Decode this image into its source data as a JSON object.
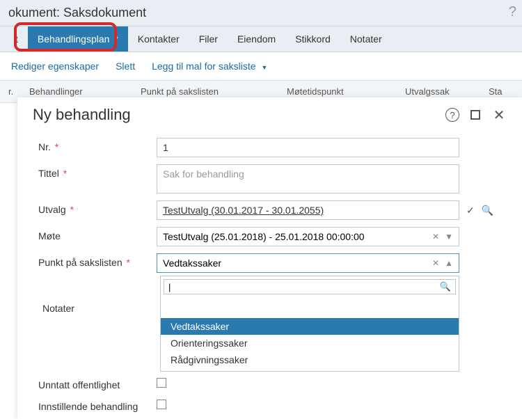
{
  "header": {
    "title_prefix": "okument: Saksdokument"
  },
  "tabs": {
    "left_cut": "t",
    "behandlingsplan": "Behandlingsplan",
    "kontakter": "Kontakter",
    "filer": "Filer",
    "eiendom": "Eiendom",
    "stikkord": "Stikkord",
    "notater": "Notater",
    "asterisk": "*"
  },
  "toolbar": {
    "rediger": "Rediger egenskaper",
    "slett": "Slett",
    "leggtil": "Legg til mal for saksliste"
  },
  "columns": {
    "r": "r.",
    "behandlinger": "Behandlinger",
    "punkt": "Punkt på sakslisten",
    "motetid": "Møtetidspunkt",
    "utvalgssak": "Utvalgssak",
    "sta": "Sta"
  },
  "modal": {
    "title": "Ny behandling",
    "fields": {
      "nr_label": "Nr.",
      "nr_value": "1",
      "tittel_label": "Tittel",
      "tittel_placeholder": "Sak for behandling",
      "utvalg_label": "Utvalg",
      "utvalg_value": "TestUtvalg (30.01.2017 - 30.01.2055)",
      "mote_label": "Møte",
      "mote_value": "TestUtvalg (25.01.2018) - 25.01.2018 00:00:00",
      "punkt_label": "Punkt på sakslisten",
      "punkt_value": "Vedtakssaker",
      "notater_label": "Notater",
      "unntatt_label": "Unntatt offentlighet",
      "innstillende_label": "Innstillende behandling",
      "req": "*"
    },
    "dropdown": {
      "opt1": "Vedtakssaker",
      "opt2": "Orienteringssaker",
      "opt3": "Rådgivningssaker"
    }
  }
}
